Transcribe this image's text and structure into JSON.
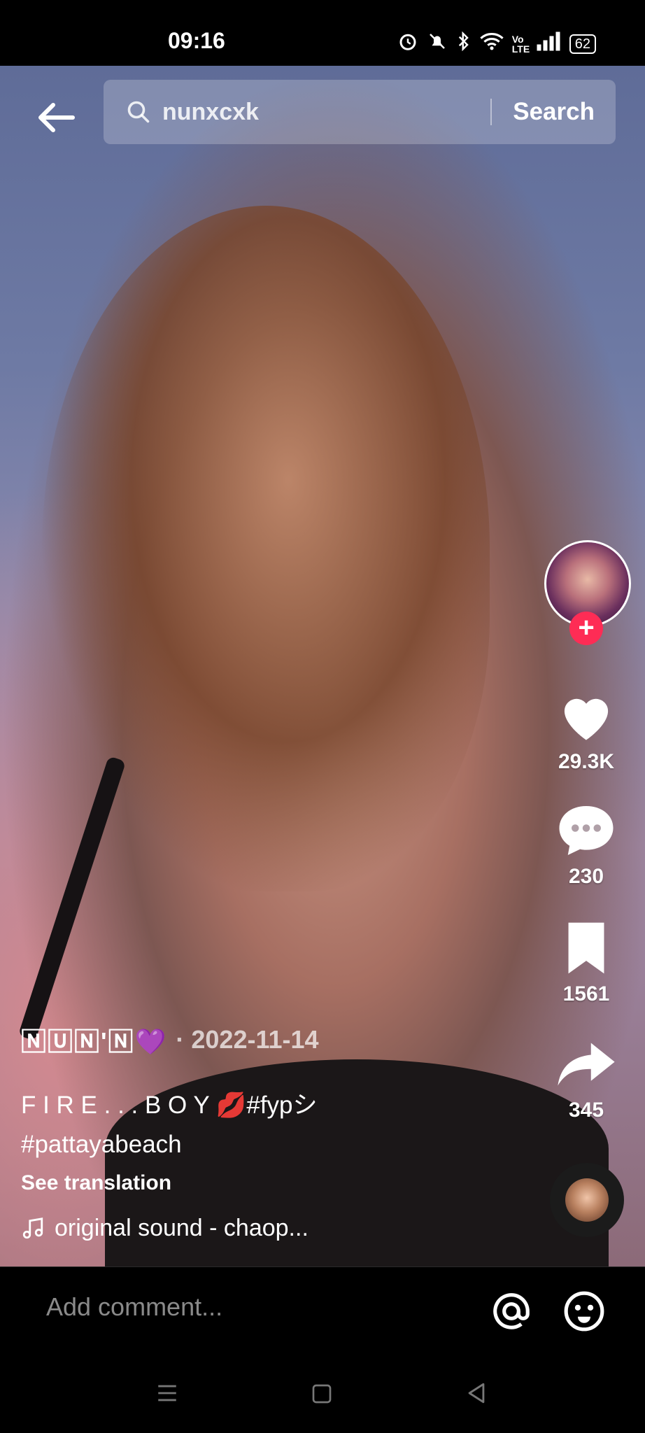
{
  "status_bar": {
    "time": "09:16",
    "network_label": "Vo LTE",
    "battery": "62"
  },
  "search": {
    "query": "nunxcxk",
    "button_label": "Search"
  },
  "actions": {
    "likes": "29.3K",
    "comments": "230",
    "saves": "1561",
    "shares": "345"
  },
  "post": {
    "username": "🄽🅄🄽'🄽💜",
    "date": "· 2022-11-14",
    "description_line1": "F I R E . . . B O Y 💋#fypシ",
    "description_line2": "#pattayabeach",
    "see_translation": "See translation",
    "sound": "original sound - chaop..."
  },
  "comment_bar": {
    "placeholder": "Add comment..."
  },
  "colors": {
    "accent": "#fe2c55",
    "placeholder": "#8a8a8a"
  }
}
